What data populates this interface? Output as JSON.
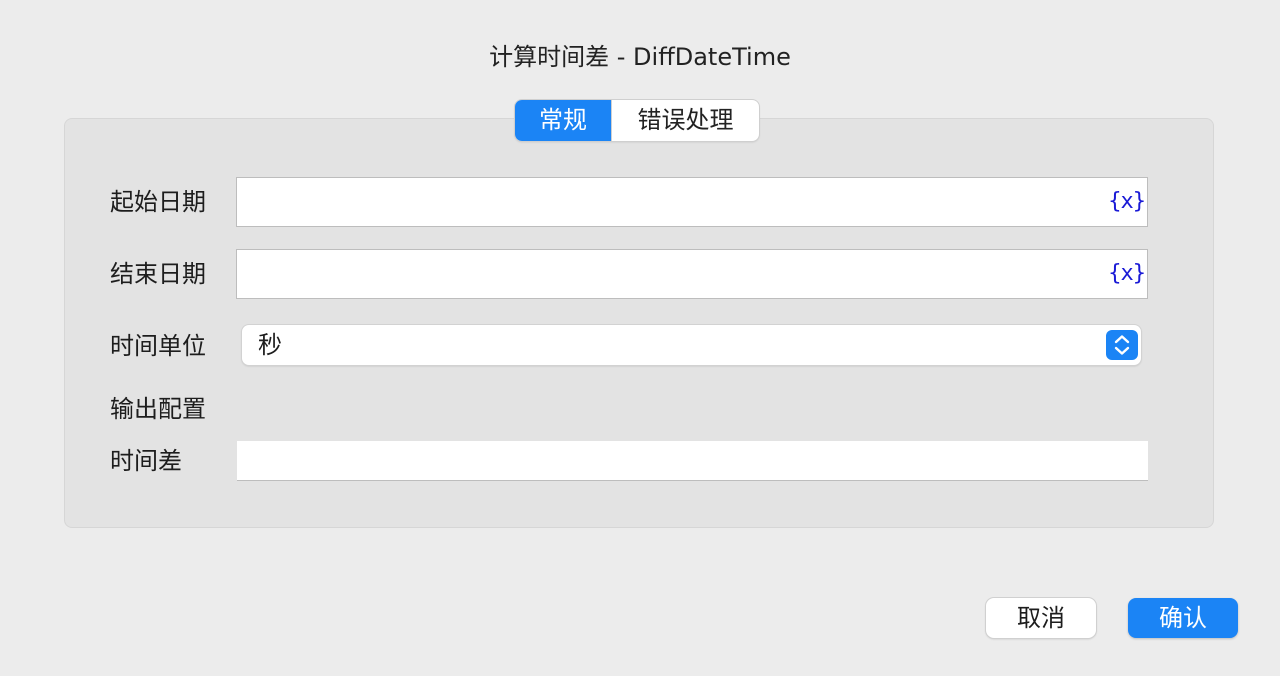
{
  "dialog": {
    "title": "计算时间差 - DiffDateTime"
  },
  "tabs": [
    {
      "label": "常规",
      "active": true
    },
    {
      "label": "错误处理",
      "active": false
    }
  ],
  "form": {
    "start_date": {
      "label": "起始日期",
      "value": "",
      "var_button": "{x}"
    },
    "end_date": {
      "label": "结束日期",
      "value": "",
      "var_button": "{x}"
    },
    "time_unit": {
      "label": "时间单位",
      "selected": "秒"
    },
    "output_section_label": "输出配置",
    "time_diff": {
      "label": "时间差",
      "value": ""
    }
  },
  "footer": {
    "cancel_label": "取消",
    "confirm_label": "确认"
  },
  "colors": {
    "accent": "#1b84f5",
    "var_button": "#1a1ad6",
    "background": "#ececec",
    "panel": "#e3e3e3"
  }
}
